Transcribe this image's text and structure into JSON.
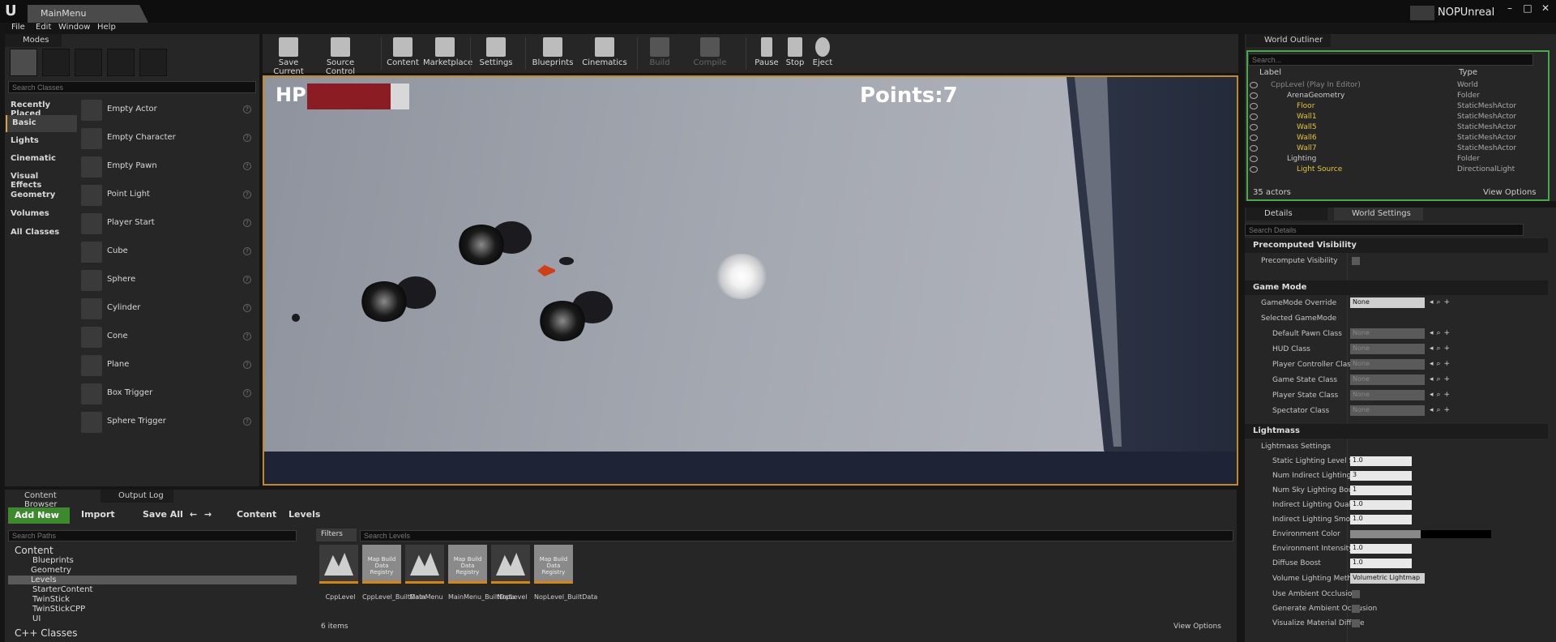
{
  "window": {
    "doc_tab": "MainMenu",
    "project_name": "NOPUnreal"
  },
  "menu": [
    "File",
    "Edit",
    "Window",
    "Help"
  ],
  "modes": {
    "tab": "Modes",
    "search_placeholder": "Search Classes",
    "categories": [
      "Recently Placed",
      "Basic",
      "Lights",
      "Cinematic",
      "Visual Effects",
      "Geometry",
      "Volumes",
      "All Classes"
    ],
    "classes": [
      "Empty Actor",
      "Empty Character",
      "Empty Pawn",
      "Point Light",
      "Player Start",
      "Cube",
      "Sphere",
      "Cylinder",
      "Cone",
      "Plane",
      "Box Trigger",
      "Sphere Trigger"
    ]
  },
  "toolbar": {
    "save_current": "Save Current",
    "source_control": "Source Control",
    "content": "Content",
    "marketplace": "Marketplace",
    "settings": "Settings",
    "blueprints": "Blueprints",
    "cinematics": "Cinematics",
    "build": "Build",
    "compile": "Compile",
    "pause": "Pause",
    "stop": "Stop",
    "eject": "Eject"
  },
  "viewport": {
    "hp_label": "HP",
    "hp_fraction": 0.82,
    "points_text": "Points:7"
  },
  "outliner": {
    "tab": "World Outliner",
    "search_placeholder": "Search...",
    "col_label": "Label",
    "col_type": "Type",
    "rows": [
      {
        "name": "CppLevel (Play In Editor)",
        "type": "World"
      },
      {
        "name": "ArenaGeometry",
        "type": "Folder"
      },
      {
        "name": "Floor",
        "type": "StaticMeshActor"
      },
      {
        "name": "Wall1",
        "type": "StaticMeshActor"
      },
      {
        "name": "Wall5",
        "type": "StaticMeshActor"
      },
      {
        "name": "Wall6",
        "type": "StaticMeshActor"
      },
      {
        "name": "Wall7",
        "type": "StaticMeshActor"
      },
      {
        "name": "Lighting",
        "type": "Folder"
      },
      {
        "name": "Light Source",
        "type": "DirectionalLight"
      }
    ],
    "actor_count": "35 actors",
    "view_options": "View Options"
  },
  "details": {
    "tab": "Details",
    "tab2": "World Settings",
    "search_placeholder": "Search Details",
    "precomputed_visibility": "Precomputed Visibility",
    "precompute_visibility": "Precompute Visibility",
    "game_mode": "Game Mode",
    "gamemode_override": "GameMode Override",
    "gamemode_override_value": "None",
    "selected_gamemode": "Selected GameMode",
    "gm_rows": [
      "Default Pawn Class",
      "HUD Class",
      "Player Controller Class",
      "Game State Class",
      "Player State Class",
      "Spectator Class"
    ],
    "none": "None",
    "lightmass": "Lightmass",
    "lightmass_settings": "Lightmass Settings",
    "lm_rows": [
      {
        "label": "Static Lighting Level Scale",
        "value": "1.0"
      },
      {
        "label": "Num Indirect Lighting Bounces",
        "value": "3"
      },
      {
        "label": "Num Sky Lighting Bounces",
        "value": "1"
      },
      {
        "label": "Indirect Lighting Quality",
        "value": "1.0"
      },
      {
        "label": "Indirect Lighting Smoothness",
        "value": "1.0"
      }
    ],
    "environment_color": "Environment Color",
    "environment_intensity": "Environment Intensity",
    "environment_intensity_value": "1.0",
    "diffuse_boost": "Diffuse Boost",
    "diffuse_boost_value": "1.0",
    "volume_lighting_method": "Volume Lighting Method",
    "volume_lighting_method_value": "Volumetric Lightmap",
    "use_ambient_occlusion": "Use Ambient Occlusion",
    "generate_ambient_occlusion": "Generate Ambient Occlusion",
    "visualize_material_diffuse": "Visualize Material Diffuse"
  },
  "content_browser": {
    "tab": "Content Browser",
    "tab2": "Output Log",
    "add_new": "Add New",
    "import": "Import",
    "save_all": "Save All",
    "crumb_content": "Content",
    "crumb_levels": "Levels",
    "path_search_placeholder": "Search Paths",
    "filters": "Filters",
    "levels_search_placeholder": "Search Levels",
    "tree": [
      "Content",
      "Blueprints",
      "Geometry",
      "Levels",
      "StarterContent",
      "TwinStick",
      "TwinStickCPP",
      "UI",
      "C++ Classes"
    ],
    "assets": [
      {
        "name": "CppLevel",
        "caption": ""
      },
      {
        "name": "CppLevel_BuiltData",
        "caption": "Map Build Data Registry"
      },
      {
        "name": "MainMenu",
        "caption": ""
      },
      {
        "name": "MainMenu_BuiltData",
        "caption": "Map Build Data Registry"
      },
      {
        "name": "NopLevel",
        "caption": ""
      },
      {
        "name": "NopLevel_BuiltData",
        "caption": "Map Build Data Registry"
      }
    ],
    "item_count": "6 items",
    "view_options": "View Options"
  }
}
